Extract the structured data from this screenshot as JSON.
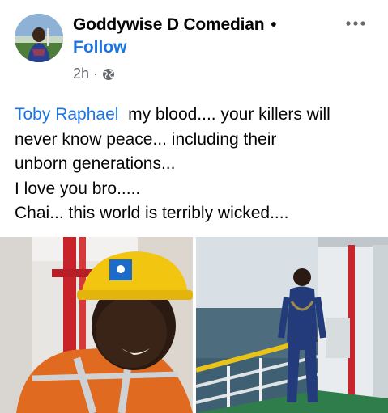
{
  "post": {
    "author": "Goddywise D Comedian",
    "author_separator": "•",
    "follow_label": "Follow",
    "time": "2h",
    "meta_separator": "·",
    "privacy_icon": "globe-icon",
    "more_icon": "more-horizontal-icon",
    "mention": "Toby Raphael",
    "text_line1_rest": "my blood.... your killers will",
    "text_line2": "never know peace... including their",
    "text_line3": "unborn generations...",
    "text_line4": "I love you bro.....",
    "text_line5": "Chai... this world is terribly wicked...."
  },
  "photos": [
    {
      "description_icon": "photo-man-yellow-helmet"
    },
    {
      "description_icon": "photo-man-on-ship-deck"
    }
  ],
  "colors": {
    "link_blue": "#1b74e4",
    "meta_gray": "#65676b",
    "text": "#050505"
  }
}
